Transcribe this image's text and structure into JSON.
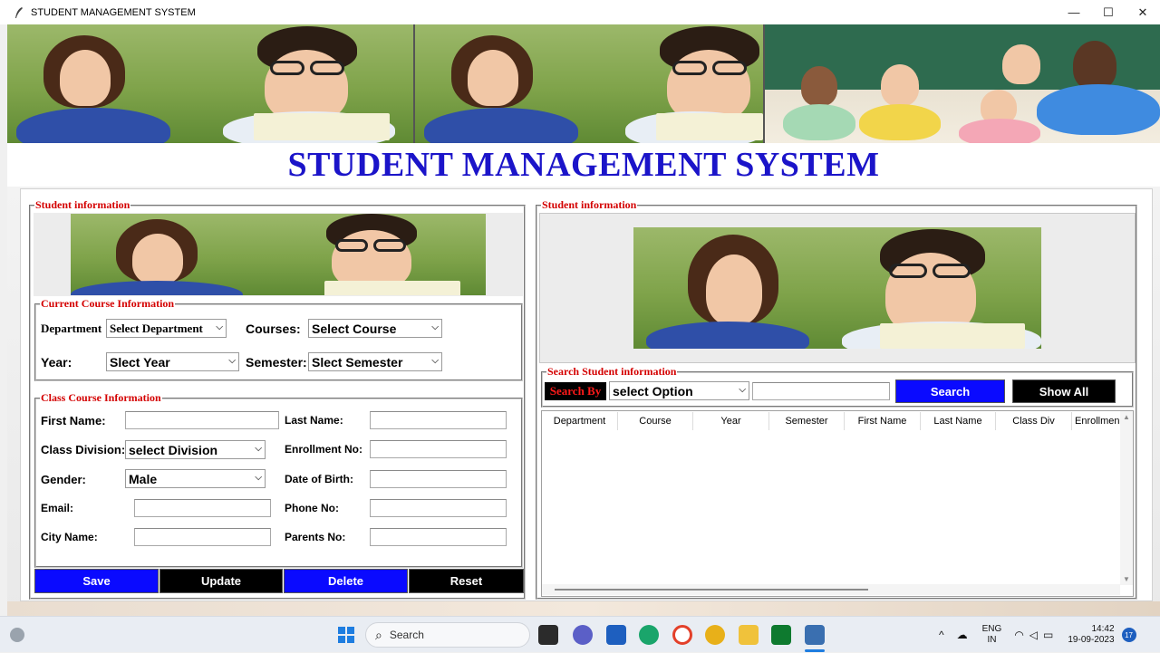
{
  "window": {
    "title": "STUDENT MANAGEMENT SYSTEM",
    "minimize": "—",
    "maximize": "☐",
    "close": "✕"
  },
  "header": {
    "title": "STUDENT MANAGEMENT SYSTEM",
    "title_color": "#1b14c9"
  },
  "left_panel": {
    "legend": "Student information",
    "course_section": {
      "legend": "Current Course Information",
      "department_label": "Department",
      "department_value": "Select Department",
      "courses_label": "Courses:",
      "courses_value": "Select Course",
      "year_label": "Year:",
      "year_value": "Slect Year",
      "semester_label": "Semester:",
      "semester_value": "Slect Semester"
    },
    "class_section": {
      "legend": "Class Course Information",
      "first_name_label": "First Name:",
      "first_name_value": "",
      "last_name_label": "Last Name:",
      "last_name_value": "",
      "class_division_label": "Class Division:",
      "class_division_value": "select Division",
      "enrollment_label": "Enrollment No:",
      "enrollment_value": "",
      "gender_label": "Gender:",
      "gender_value": "Male",
      "dob_label": "Date of Birth:",
      "dob_value": "",
      "email_label": "Email:",
      "email_value": "",
      "phone_label": "Phone No:",
      "phone_value": "",
      "city_label": "City Name:",
      "city_value": "",
      "parents_label": "Parents No:",
      "parents_value": ""
    },
    "buttons": {
      "save": "Save",
      "update": "Update",
      "delete": "Delete",
      "reset": "Reset"
    }
  },
  "right_panel": {
    "legend": "Student information",
    "search_section": {
      "legend": "Search Student information",
      "search_by_label": "Search By",
      "option_value": "select Option",
      "search_text": "",
      "search_button": "Search",
      "show_all_button": "Show All"
    },
    "table": {
      "columns": [
        "Department",
        "Course",
        "Year",
        "Semester",
        "First Name",
        "Last Name",
        "Class Div",
        "Enrollmen"
      ],
      "rows": []
    }
  },
  "taskbar": {
    "search_placeholder": "Search",
    "language_line1": "ENG",
    "language_line2": "IN",
    "time": "14:42",
    "date": "19-09-2023",
    "notification_count": "17"
  },
  "colors": {
    "accent_blue": "#0a0aff",
    "legend_red": "#d40000",
    "button_black": "#000000"
  }
}
